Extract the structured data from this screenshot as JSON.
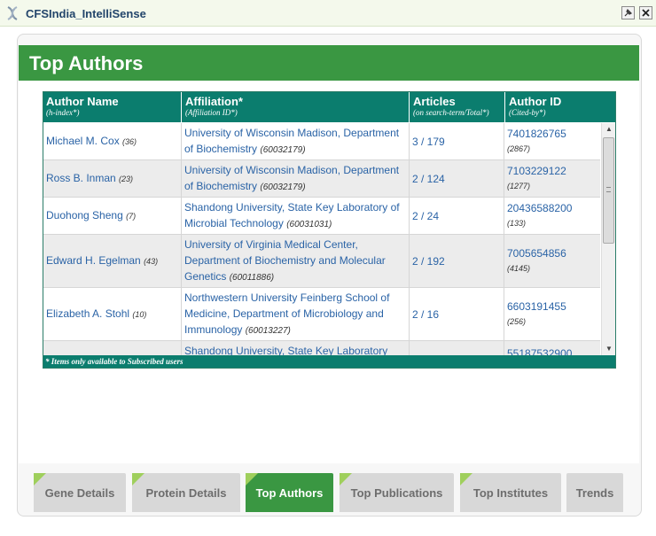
{
  "app": {
    "title": "CFSIndia_IntelliSense"
  },
  "section": {
    "title": "Top Authors"
  },
  "table": {
    "headers": [
      {
        "main": "Author Name",
        "sub": "(h-index*)"
      },
      {
        "main": "Affiliation*",
        "sub": "(Affiliation ID*)"
      },
      {
        "main": "Articles",
        "sub": "(on search-term/Total*)"
      },
      {
        "main": "Author ID",
        "sub": "(Cited-by*)"
      }
    ],
    "rows": [
      {
        "name": "Michael M. Cox",
        "hindex": "(36)",
        "affiliation": "University of Wisconsin Madison, Department of Biochemistry",
        "aff_id": "(60032179)",
        "articles": "3 / 179",
        "author_id": "7401826765",
        "cited": "(2867)"
      },
      {
        "name": "Ross B. Inman",
        "hindex": "(23)",
        "affiliation": "University of Wisconsin Madison, Department of Biochemistry",
        "aff_id": "(60032179)",
        "articles": "2 / 124",
        "author_id": "7103229122",
        "cited": "(1277)"
      },
      {
        "name": "Duohong Sheng",
        "hindex": "(7)",
        "affiliation": "Shandong University, State Key Laboratory of Microbial Technology",
        "aff_id": "(60031031)",
        "articles": "2 / 24",
        "author_id": "20436588200",
        "cited": "(133)"
      },
      {
        "name": "Edward H. Egelman",
        "hindex": "(43)",
        "affiliation": "University of Virginia Medical Center, Department of Biochemistry and Molecular Genetics",
        "aff_id": "(60011886)",
        "articles": "2 / 192",
        "author_id": "7005654856",
        "cited": "(4145)"
      },
      {
        "name": "Elizabeth A. Stohl",
        "hindex": "(10)",
        "affiliation": "Northwestern University Feinberg School of Medicine, Department of Microbiology and Immunology",
        "aff_id": "(60013227)",
        "articles": "2 / 16",
        "author_id": "6603191455",
        "cited": "(256)"
      },
      {
        "name": "",
        "hindex": "",
        "affiliation": "Shandong University, State Key Laboratory",
        "aff_id": "",
        "articles": "",
        "author_id": "55187532900",
        "cited": ""
      }
    ],
    "footnote": "* Items only available to Subscribed users"
  },
  "tabs": [
    {
      "label": "Gene Details",
      "active": false
    },
    {
      "label": "Protein Details",
      "active": false
    },
    {
      "label": "Top Authors",
      "active": true
    },
    {
      "label": "Top Publications",
      "active": false
    },
    {
      "label": "Top Institutes",
      "active": false
    },
    {
      "label": "Trends",
      "active": false
    }
  ],
  "colors": {
    "accent_green": "#3a9742",
    "table_header": "#0b7d6e",
    "link_blue": "#2a63a6",
    "tab_inactive": "#d8d8d8"
  },
  "icons": {
    "app": "dna-helix-icon",
    "pin": "pin-icon",
    "close": "close-icon",
    "tab_marker": "check-icon"
  }
}
